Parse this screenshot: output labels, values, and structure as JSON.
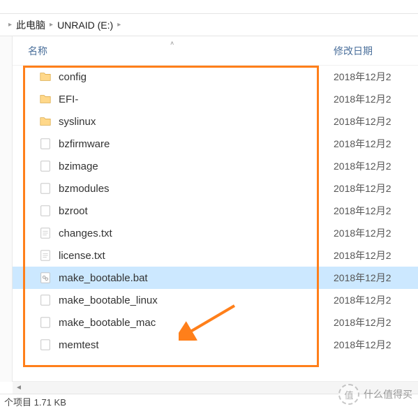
{
  "breadcrumb": {
    "item1": "此电脑",
    "item2": "UNRAID (E:)"
  },
  "columns": {
    "name": "名称",
    "date": "修改日期"
  },
  "files": [
    {
      "name": "config",
      "type": "folder",
      "date": "2018年12月2"
    },
    {
      "name": "EFI-",
      "type": "folder",
      "date": "2018年12月2"
    },
    {
      "name": "syslinux",
      "type": "folder",
      "date": "2018年12月2"
    },
    {
      "name": "bzfirmware",
      "type": "file",
      "date": "2018年12月2"
    },
    {
      "name": "bzimage",
      "type": "file",
      "date": "2018年12月2"
    },
    {
      "name": "bzmodules",
      "type": "file",
      "date": "2018年12月2"
    },
    {
      "name": "bzroot",
      "type": "file",
      "date": "2018年12月2"
    },
    {
      "name": "changes.txt",
      "type": "txt",
      "date": "2018年12月2"
    },
    {
      "name": "license.txt",
      "type": "txt",
      "date": "2018年12月2"
    },
    {
      "name": "make_bootable.bat",
      "type": "bat",
      "date": "2018年12月2",
      "selected": true
    },
    {
      "name": "make_bootable_linux",
      "type": "file",
      "date": "2018年12月2"
    },
    {
      "name": "make_bootable_mac",
      "type": "file",
      "date": "2018年12月2"
    },
    {
      "name": "memtest",
      "type": "file",
      "date": "2018年12月2"
    }
  ],
  "status": {
    "text": "个项目  1.71 KB"
  },
  "watermark": {
    "badge": "值",
    "text": "什么值得买"
  }
}
